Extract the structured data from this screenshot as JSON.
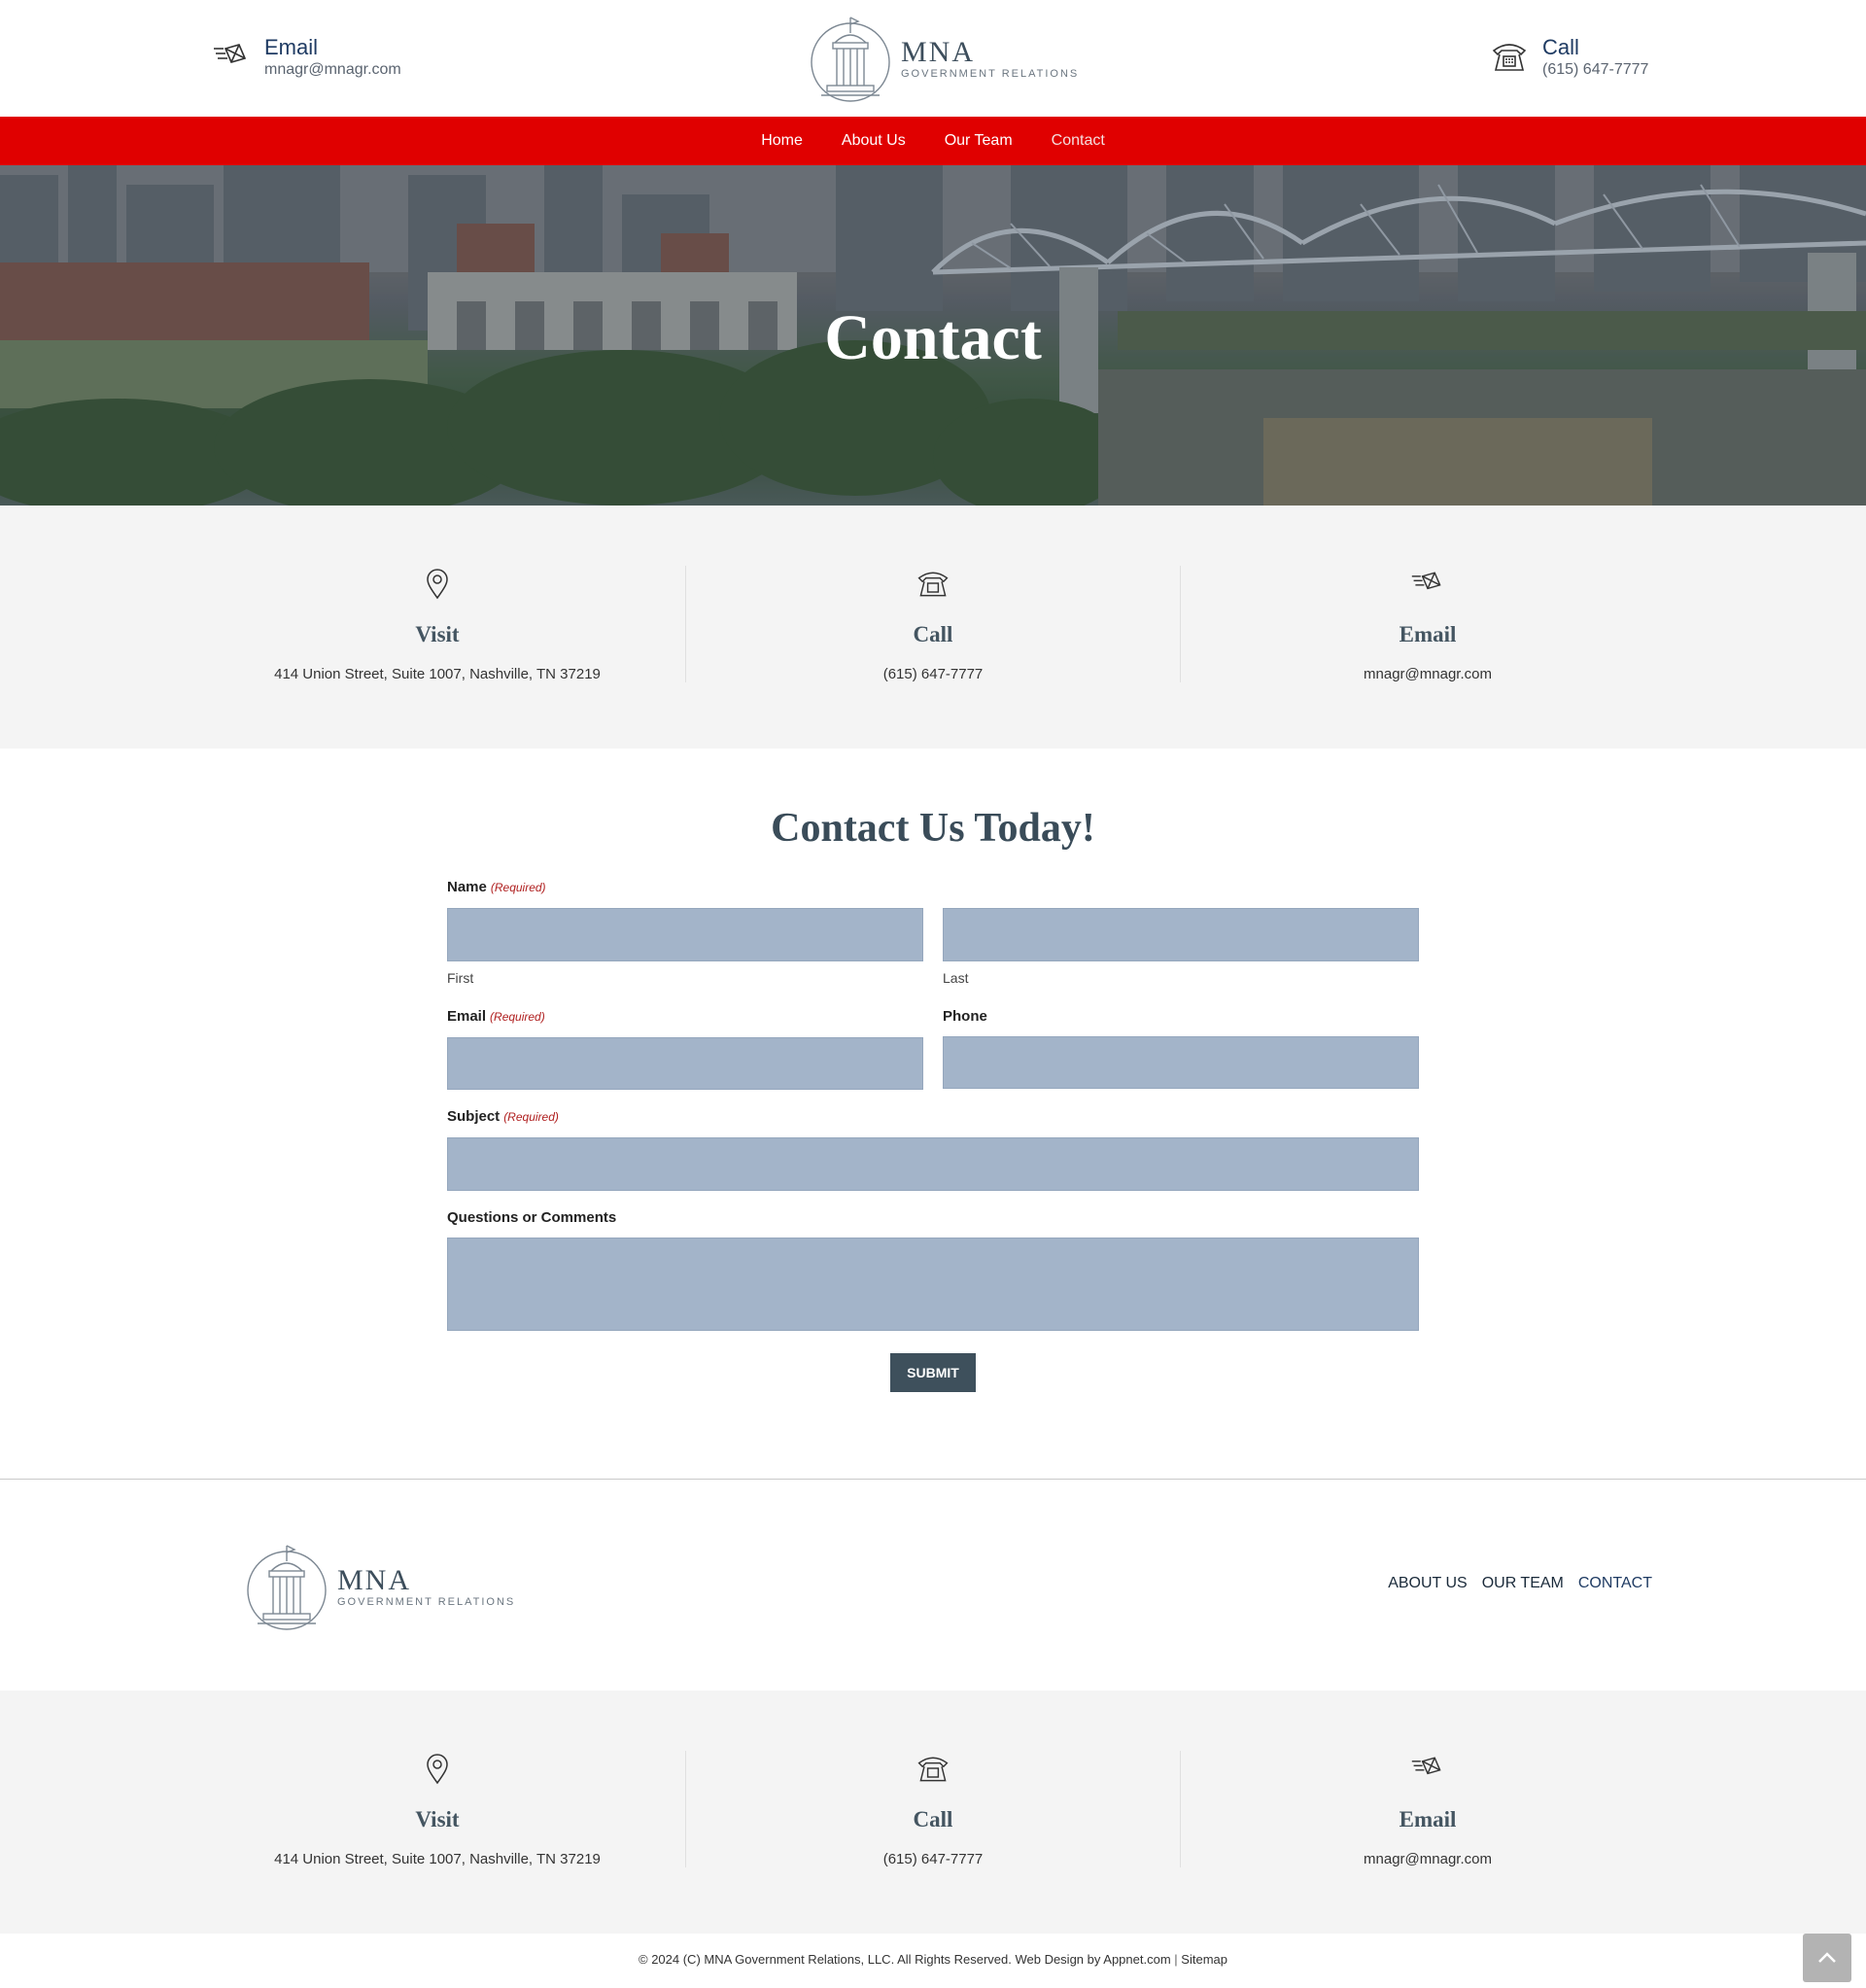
{
  "header": {
    "email": {
      "label": "Email",
      "value": "mnagr@mnagr.com",
      "icon": "email-icon"
    },
    "call": {
      "label": "Call",
      "value": "(615) 647-7777",
      "icon": "phone-icon"
    },
    "logo": {
      "name": "MNA",
      "tagline": "GOVERNMENT RELATIONS"
    }
  },
  "nav": {
    "items": [
      {
        "label": "Home"
      },
      {
        "label": "About Us"
      },
      {
        "label": "Our Team"
      },
      {
        "label": "Contact"
      }
    ],
    "active": "Contact",
    "color": "#e00000"
  },
  "hero": {
    "title": "Contact"
  },
  "info": {
    "visit": {
      "title": "Visit",
      "value": "414 Union Street, Suite 1007, Nashville, TN 37219",
      "icon": "location-pin-icon"
    },
    "call": {
      "title": "Call",
      "value": "(615) 647-7777",
      "icon": "phone-icon"
    },
    "email": {
      "title": "Email",
      "value": "mnagr@mnagr.com",
      "icon": "email-icon"
    }
  },
  "form": {
    "title": "Contact Us Today!",
    "required_text": "(Required)",
    "name_label": "Name",
    "first_label": "First",
    "last_label": "Last",
    "email_label": "Email",
    "phone_label": "Phone",
    "subject_label": "Subject",
    "comments_label": "Questions or Comments",
    "submit_label": "SUBMIT",
    "field_color": "#a3b4c9"
  },
  "footer": {
    "logo": {
      "name": "MNA",
      "tagline": "GOVERNMENT RELATIONS"
    },
    "links": [
      {
        "label": "ABOUT US"
      },
      {
        "label": "OUR TEAM"
      },
      {
        "label": "CONTACT"
      }
    ],
    "info": {
      "visit": {
        "title": "Visit",
        "value": "414 Union Street, Suite 1007, Nashville, TN 37219"
      },
      "call": {
        "title": "Call",
        "value": "(615) 647-7777"
      },
      "email": {
        "title": "Email",
        "value": "mnagr@mnagr.com"
      }
    },
    "copyright": "© 2024 (C) MNA Government Relations, LLC. All Rights Reserved. Web Design by Appnet.com",
    "separator": "|",
    "sitemap": "Sitemap"
  }
}
